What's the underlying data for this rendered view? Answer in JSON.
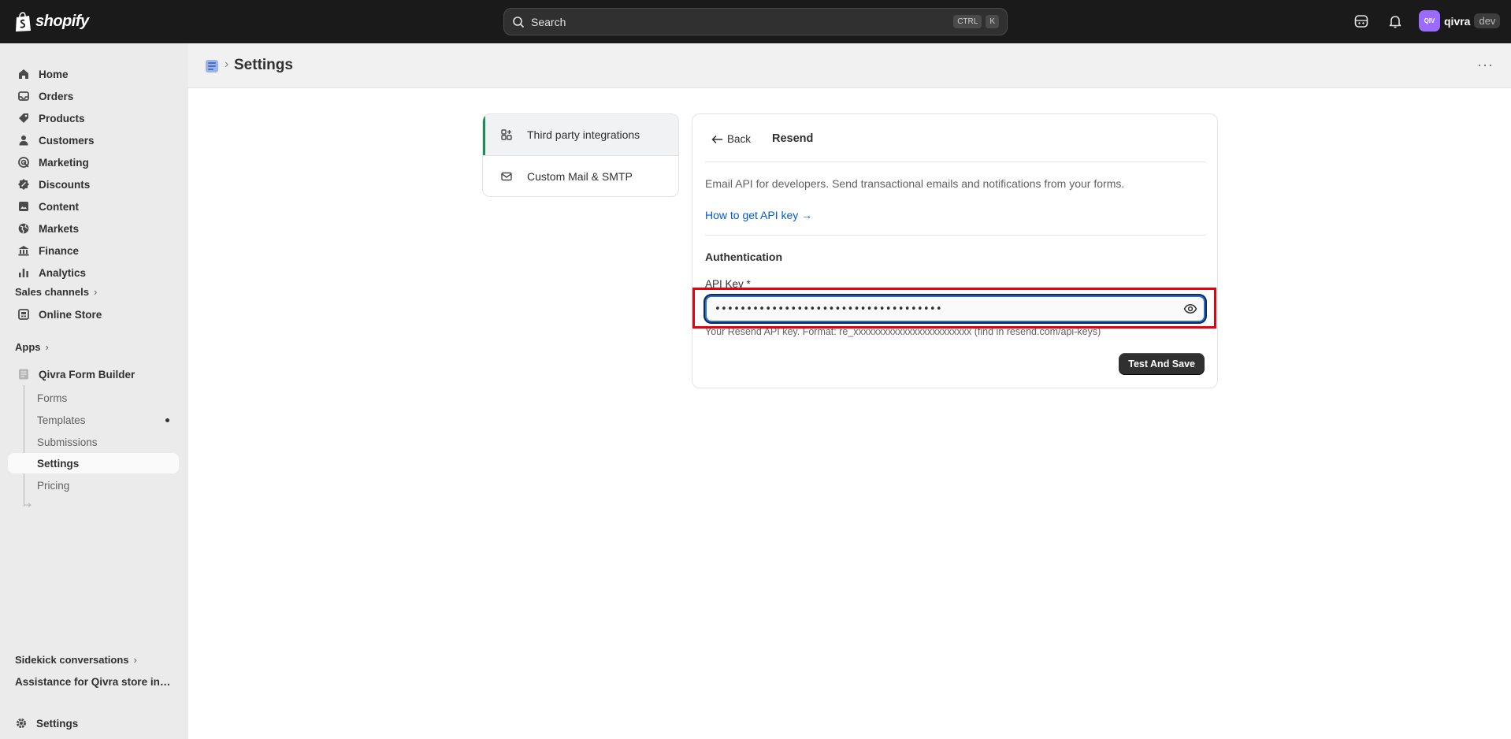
{
  "topbar": {
    "brand": "shopify",
    "search_placeholder": "Search",
    "shortcut_keys": [
      "CTRL",
      "K"
    ],
    "account_initials": "QIV",
    "account_name": "qivra",
    "account_tag": "dev",
    "colors": {
      "bar_bg": "#1a1a1a",
      "avatar_bg": "#9b6bff"
    }
  },
  "sidebar": {
    "main_items": [
      {
        "label": "Home",
        "icon": "home-icon"
      },
      {
        "label": "Orders",
        "icon": "inbox-icon"
      },
      {
        "label": "Products",
        "icon": "tag-icon"
      },
      {
        "label": "Customers",
        "icon": "person-icon"
      },
      {
        "label": "Marketing",
        "icon": "target-icon"
      },
      {
        "label": "Discounts",
        "icon": "discount-icon"
      },
      {
        "label": "Content",
        "icon": "content-icon"
      },
      {
        "label": "Markets",
        "icon": "globe-icon"
      },
      {
        "label": "Finance",
        "icon": "bank-icon"
      },
      {
        "label": "Analytics",
        "icon": "bar-chart-icon"
      }
    ],
    "sales_channels_label": "Sales channels",
    "online_store_label": "Online Store",
    "apps_label": "Apps",
    "app_name": "Qivra Form Builder",
    "app_subitems": [
      "Forms",
      "Templates",
      "Submissions",
      "Settings",
      "Pricing"
    ],
    "active_subitem": "Settings",
    "sidekick_label": "Sidekick conversations",
    "sidekick_item": "Assistance for Qivra store inquiries",
    "settings_label": "Settings"
  },
  "page_header": {
    "title": "Settings"
  },
  "settings_tabs": [
    {
      "label": "Third party integrations",
      "icon": "apps-icon",
      "active": true
    },
    {
      "label": "Custom Mail & SMTP",
      "icon": "mail-icon",
      "active": false
    }
  ],
  "integration": {
    "back_label": "Back",
    "title": "Resend",
    "description": "Email API for developers. Send transactional emails and notifications from your forms.",
    "help_link": "How to get API key →",
    "section_heading": "Authentication",
    "api_key_label": "API Key *",
    "api_key_value": "••••••••••••••••••••••••••••••••••••",
    "api_key_help": "Your Resend API key. Format: re_xxxxxxxxxxxxxxxxxxxxxxxx (find in resend.com/api-keys)",
    "save_button": "Test And Save",
    "colors": {
      "link": "#005bd3",
      "focus_ring": "#2c6ecb",
      "highlight": "#e8000b",
      "active_tab_accent": "#1f8a5b"
    }
  }
}
